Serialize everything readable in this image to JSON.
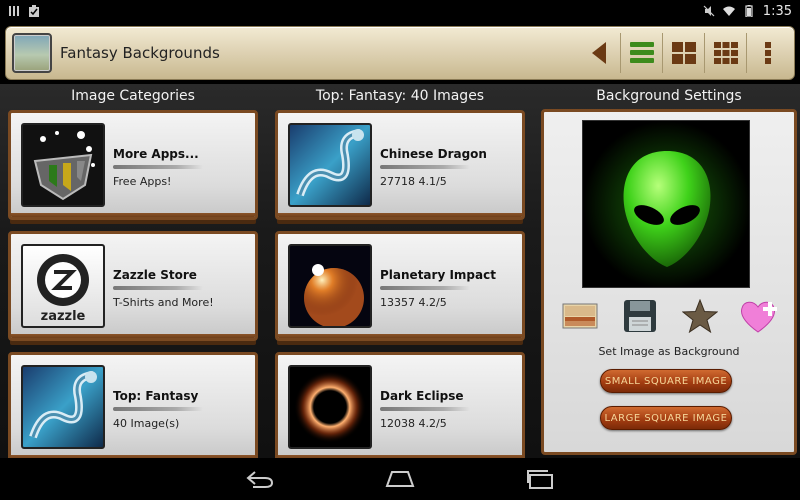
{
  "status_bar": {
    "time": "1:35",
    "left_icons": [
      "sim-icon",
      "clipboard-check-icon"
    ],
    "right_icons": [
      "mute-icon",
      "wifi-icon",
      "battery-icon"
    ]
  },
  "action_bar": {
    "title": "Fantasy Backgrounds",
    "buttons": [
      "back-arrow-icon",
      "list-view-icon",
      "grid-2x2-icon",
      "grid-3x3-icon",
      "overflow-menu-icon"
    ]
  },
  "columns": {
    "categories_header": "Image Categories",
    "images_header": "Top: Fantasy: 40 Images",
    "settings_header": "Background Settings"
  },
  "categories": [
    {
      "title": "More Apps...",
      "subtitle": "Free Apps!"
    },
    {
      "title": "Zazzle Store",
      "subtitle": "T-Shirts and More!"
    },
    {
      "title": "Top: Fantasy",
      "subtitle": "40 Image(s)"
    }
  ],
  "images": [
    {
      "title": "Chinese Dragon",
      "subtitle": "27718 4.1/5"
    },
    {
      "title": "Planetary Impact",
      "subtitle": "13357 4.2/5"
    },
    {
      "title": "Dark Eclipse",
      "subtitle": "12038 4.2/5"
    }
  ],
  "settings": {
    "tools": [
      "landscape-image-icon",
      "save-floppy-icon",
      "star-icon",
      "heart-plus-icon"
    ],
    "label": "Set Image as Background",
    "small_button": "SMALL SQUARE IMAGE",
    "large_button": "LARGE SQUARE IMAGE"
  },
  "nav_bar": [
    "back-icon",
    "home-icon",
    "recents-icon"
  ],
  "colors": {
    "wood": "#7a4a22",
    "action_bar": "#d9ccab",
    "pill": "#a53e12",
    "alien_green": "#3fd21a"
  }
}
